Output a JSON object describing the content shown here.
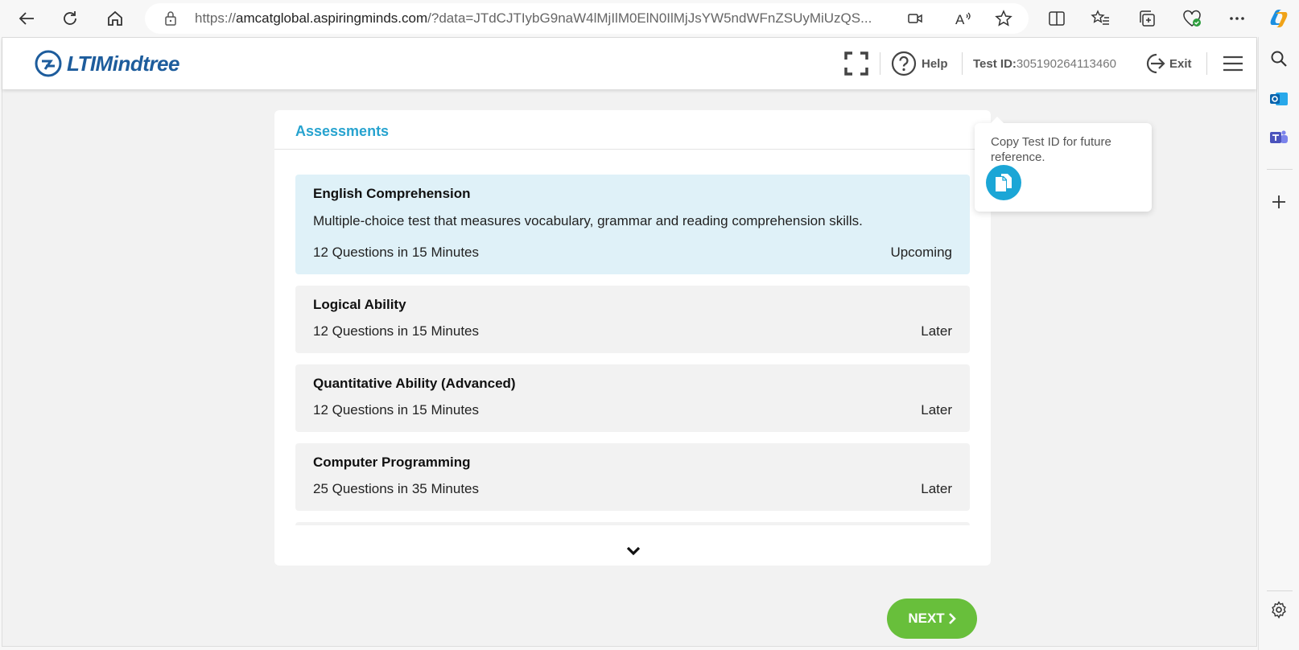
{
  "browser": {
    "url_prefix": "https://",
    "url_host": "amcatglobal.aspiringminds.com",
    "url_rest": "/?data=JTdCJTIybG9naW4lMjIlM0ElN0IlMjJsYW5ndWFnZSUyMiUzQS..."
  },
  "header": {
    "logo_text": "LTIMindtree",
    "help_label": "Help",
    "test_id_label": "Test ID:",
    "test_id_value": "305190264113460",
    "exit_label": "Exit"
  },
  "tooltip": {
    "text": "Copy Test ID for future reference."
  },
  "assessments": {
    "title": "Assessments",
    "items": [
      {
        "name": "English Comprehension",
        "description": "Multiple-choice test that measures vocabulary, grammar and reading comprehension skills.",
        "meta": "12 Questions in 15 Minutes",
        "status": "Upcoming"
      },
      {
        "name": "Logical Ability",
        "meta": "12 Questions in 15 Minutes",
        "status": "Later"
      },
      {
        "name": "Quantitative Ability (Advanced)",
        "meta": "12 Questions in 15 Minutes",
        "status": "Later"
      },
      {
        "name": "Computer Programming",
        "meta": "25 Questions in 35 Minutes",
        "status": "Later"
      }
    ]
  },
  "next_label": "NEXT",
  "colors": {
    "accent": "#27a3cf",
    "brand": "#1d5c9c",
    "next_button": "#68bf3b",
    "active_item": "#dff1f8"
  }
}
